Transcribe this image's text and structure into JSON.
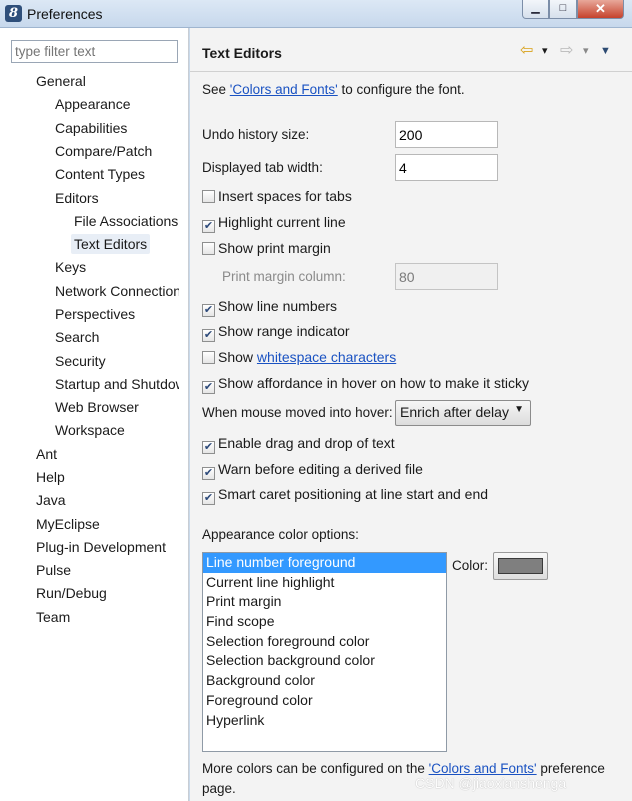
{
  "window": {
    "title": "Preferences",
    "app_icon_glyph": "8",
    "minimize_glyph": "▁",
    "maximize_glyph": "□",
    "close_glyph": "✕"
  },
  "sidebar": {
    "filter_placeholder": "type filter text",
    "items": [
      {
        "label": "General"
      },
      {
        "label": "Appearance"
      },
      {
        "label": "Capabilities"
      },
      {
        "label": "Compare/Patch"
      },
      {
        "label": "Content Types"
      },
      {
        "label": "Editors"
      },
      {
        "label": "File Associations"
      },
      {
        "label": "Text Editors"
      },
      {
        "label": "Keys"
      },
      {
        "label": "Network Connections"
      },
      {
        "label": "Perspectives"
      },
      {
        "label": "Search"
      },
      {
        "label": "Security"
      },
      {
        "label": "Startup and Shutdown"
      },
      {
        "label": "Web Browser"
      },
      {
        "label": "Workspace"
      },
      {
        "label": "Ant"
      },
      {
        "label": "Help"
      },
      {
        "label": "Java"
      },
      {
        "label": "MyEclipse"
      },
      {
        "label": "Plug-in Development"
      },
      {
        "label": "Pulse"
      },
      {
        "label": "Run/Debug"
      },
      {
        "label": "Team"
      }
    ],
    "selected": "Text Editors"
  },
  "header": {
    "title": "Text Editors",
    "back_icon": "back-arrow-icon",
    "forward_icon": "forward-arrow-icon",
    "back_glyph": "⇦",
    "forward_glyph": "⇨",
    "dropdown_glyph": "▾",
    "menu_glyph": "▼"
  },
  "content": {
    "intro_prefix": "See ",
    "intro_link": "'Colors and Fonts'",
    "intro_suffix": " to configure the font.",
    "undo_label": "Undo history size:",
    "undo_value": "200",
    "tab_width_label": "Displayed tab width:",
    "tab_width_value": "4",
    "print_margin_column_label": "Print margin column:",
    "print_margin_column_value": "80",
    "checkboxes": [
      {
        "label": "Insert spaces for tabs",
        "checked": false
      },
      {
        "label": "Highlight current line",
        "checked": true
      },
      {
        "label": "Show print margin",
        "checked": false
      },
      {
        "label": "Show line numbers",
        "checked": true
      },
      {
        "label": "Show range indicator",
        "checked": true
      },
      {
        "label_prefix": "Show ",
        "label_link": "whitespace characters",
        "checked": false
      },
      {
        "label": "Show affordance in hover on how to make it sticky",
        "checked": true
      },
      {
        "label": "Enable drag and drop of text",
        "checked": true
      },
      {
        "label": "Warn before editing a derived file",
        "checked": true
      },
      {
        "label": "Smart caret positioning at line start and end",
        "checked": true
      }
    ],
    "check_glyph": "✔",
    "hover_label": "When mouse moved into hover:",
    "hover_value": "Enrich after delay",
    "appearance_label": "Appearance color options:",
    "color_options": [
      "Line number foreground",
      "Current line highlight",
      "Print margin",
      "Find scope",
      "Selection foreground color",
      "Selection background color",
      "Background color",
      "Foreground color",
      "Hyperlink"
    ],
    "selected_color_option": "Line number foreground",
    "color_label": "Color:",
    "color_value": "#7f7f7f",
    "footer_prefix": "More colors can be configured on the ",
    "footer_link": "'Colors and Fonts'",
    "footer_suffix": " preference",
    "footer_line2": "page."
  },
  "watermark": "CSDN @jiaoxianshenga"
}
